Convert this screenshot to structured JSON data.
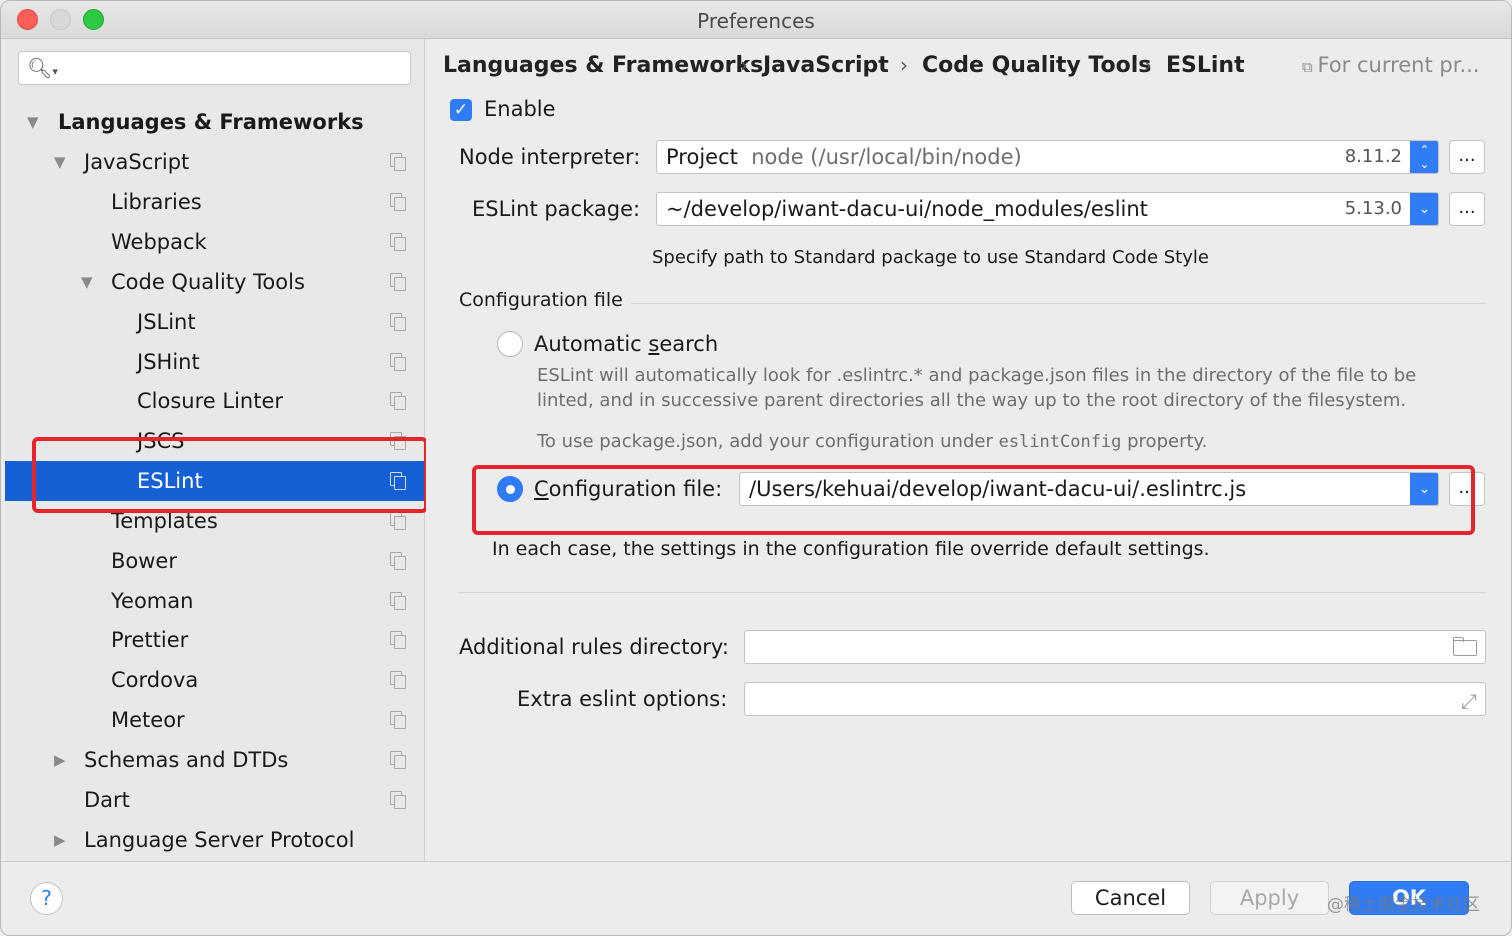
{
  "window": {
    "title": "Preferences"
  },
  "sidebar": {
    "search_placeholder": "",
    "items": [
      {
        "label": "Languages & Frameworks"
      },
      {
        "label": "JavaScript"
      },
      {
        "label": "Libraries"
      },
      {
        "label": "Webpack"
      },
      {
        "label": "Code Quality Tools"
      },
      {
        "label": "JSLint"
      },
      {
        "label": "JSHint"
      },
      {
        "label": "Closure Linter"
      },
      {
        "label": "JSCS"
      },
      {
        "label": "ESLint"
      },
      {
        "label": "Templates"
      },
      {
        "label": "Bower"
      },
      {
        "label": "Yeoman"
      },
      {
        "label": "Prettier"
      },
      {
        "label": "Cordova"
      },
      {
        "label": "Meteor"
      },
      {
        "label": "Schemas and DTDs"
      },
      {
        "label": "Dart"
      },
      {
        "label": "Language Server Protocol"
      }
    ],
    "selected": "ESLint"
  },
  "breadcrumb": [
    "Languages & Frameworks",
    "JavaScript",
    "Code Quality Tools",
    "ESLint"
  ],
  "breadcrumb_separator": "›",
  "scope_label": "For current pr...",
  "enable": {
    "label": "Enable",
    "checked": true
  },
  "node_interpreter": {
    "label": "Node interpreter:",
    "type": "Project",
    "path": "node (/usr/local/bin/node)",
    "version": "8.11.2"
  },
  "eslint_package": {
    "label": "ESLint package:",
    "path": "~/develop/iwant-dacu-ui/node_modules/eslint",
    "version": "5.13.0"
  },
  "package_hint": "Specify path to Standard package to use Standard Code Style",
  "configuration": {
    "section_title": "Configuration file",
    "auto_search": {
      "label_pre": "Automatic ",
      "label_mnemonic": "s",
      "label_post": "earch",
      "selected": false,
      "desc_line1": "ESLint will automatically look for .eslintrc.* and package.json files in the directory of the file to be",
      "desc_line2": "linted, and in successive parent directories all the way up to the root directory of the filesystem.",
      "pkg_pre": "To use package.json, add your configuration under ",
      "pkg_code": "eslintConfig",
      "pkg_post": " property."
    },
    "config_file": {
      "label_mnemonic": "C",
      "label_post": "onfiguration file:",
      "selected": true,
      "path": "/Users/kehuai/develop/iwant-dacu-ui/.eslintrc.js"
    },
    "override_note": "In each case, the settings in the configuration file override default settings."
  },
  "additional_rules": {
    "label": "Additional rules directory:",
    "value": ""
  },
  "extra_options": {
    "label": "Extra eslint options:",
    "value": ""
  },
  "buttons": {
    "more": "...",
    "help": "?",
    "cancel": "Cancel",
    "apply": "Apply",
    "ok": "OK"
  },
  "watermark": "@稀土掘金技术社区",
  "colors": {
    "accent": "#2f7cf6",
    "selection": "#1560d4",
    "highlight_box": "#e5252b"
  }
}
